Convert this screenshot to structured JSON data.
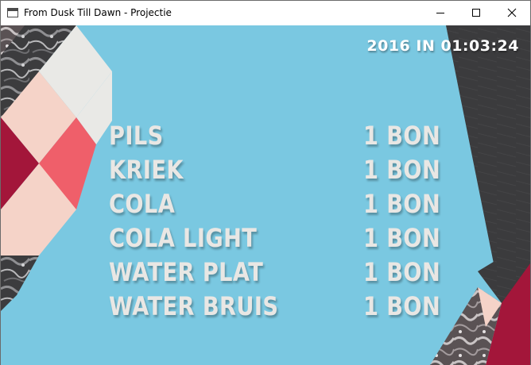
{
  "window": {
    "title": "From Dusk Till Dawn - Projectie",
    "icon": "window-icon",
    "controls": [
      "minimize-icon",
      "maximize-icon",
      "close-icon"
    ]
  },
  "clock": "2016 IN 01:03:24",
  "menu": [
    {
      "item": "PILS",
      "price": "1 BON"
    },
    {
      "item": "KRIEK",
      "price": "1 BON"
    },
    {
      "item": "COLA",
      "price": "1 BON"
    },
    {
      "item": "COLA LIGHT",
      "price": "1 BON"
    },
    {
      "item": "WATER PLAT",
      "price": "1 BON"
    },
    {
      "item": "WATER BRUIS",
      "price": "1 BON"
    }
  ],
  "colors": {
    "background": "#7ac8e1",
    "text": "#e9e7e4",
    "crimson": "#a3163a",
    "salmon": "#ef5f6a",
    "blush": "#f5d3c8",
    "light_grey": "#e9e9e6",
    "charcoal": "#3a3a3c"
  }
}
